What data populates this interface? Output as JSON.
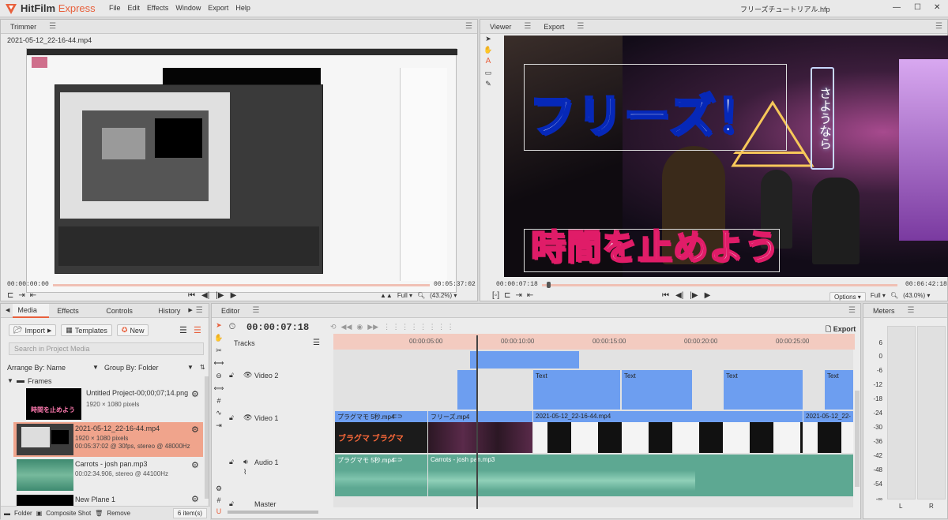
{
  "app": {
    "name_left": "HitFilm",
    "name_right": "Express",
    "file": "フリーズチュートリアル.hfp"
  },
  "menu": [
    "File",
    "Edit",
    "Effects",
    "Window",
    "Export",
    "Help"
  ],
  "window_controls": {
    "min": "—",
    "max": "☐",
    "close": "✕"
  },
  "trimmer": {
    "tab": "Trimmer",
    "filename": "2021-05-12_22-16-44.mp4",
    "time_start": "00:00:00:00",
    "time_end": "00:05:37:02",
    "full": "Full ▾",
    "zoom": "(43.2%) ▾"
  },
  "viewer": {
    "tab": "Viewer",
    "tab2": "Export",
    "time_start": "00:00:07:18",
    "time_end": "00:06:42:18",
    "options": "Options ▾",
    "full": "Full ▾",
    "zoom": "(43.0%) ▾",
    "title_text": "フリーズ！",
    "subtitle_text": "時間を止めよう",
    "sign_text": "さようなら"
  },
  "media": {
    "tabs": [
      "Media",
      "Effects",
      "Controls",
      "History"
    ],
    "import": "Import",
    "templates": "Templates",
    "new": "New",
    "search_placeholder": "Search in Project Media",
    "arrange": "Arrange By: Name",
    "group": "Group By: Folder",
    "folder": "Frames",
    "items": [
      {
        "name": "Untitled Project-00;00;07;14.png",
        "line1": "1920 × 1080 pixels",
        "line2": ""
      },
      {
        "name": "2021-05-12_22-16-44.mp4",
        "line1": "1920 × 1080 pixels",
        "line2": "00:05:37:02 @ 30fps, stereo @ 48000Hz"
      },
      {
        "name": "Carrots - josh pan.mp3",
        "line1": "00:02:34.906, stereo @ 44100Hz",
        "line2": ""
      },
      {
        "name": "New Plane 1",
        "line1": "",
        "line2": ""
      }
    ],
    "footer": {
      "folder": "Folder",
      "composite": "Composite Shot",
      "remove": "Remove",
      "count": "6 item(s)"
    }
  },
  "editor": {
    "tab": "Editor",
    "time": "00:00:07:18",
    "export": "Export",
    "tracks_label": "Tracks",
    "ruler": [
      "00:00:05:00",
      "00:00:10:00",
      "00:00:15:00",
      "00:00:20:00",
      "00:00:25:00"
    ],
    "tracks": [
      "Video 2",
      "Video 1",
      "Audio 1",
      "Master"
    ],
    "video2_clips": [
      "Text",
      "Text",
      "Text",
      "Text"
    ],
    "video1_clips": [
      "プラグマモ 5秒.mp4",
      "フリーズ.mp4",
      "2021-05-12_22-16-44.mp4",
      "2021-05-12_22-"
    ],
    "audio1_clips": [
      "プラグマモ 5秒.mp4",
      "Carrots - josh pan.mp3"
    ]
  },
  "meters": {
    "tab": "Meters",
    "scale": [
      "6",
      "0",
      "-6",
      "-12",
      "-18",
      "-24",
      "-30",
      "-36",
      "-42",
      "-48",
      "-54",
      "-∞"
    ],
    "L": "L",
    "R": "R"
  },
  "colors": {
    "accent": "#e8603c",
    "clip_blue": "#6d9ef0",
    "clip_green": "#5da892",
    "ruler_pink": "#f3cbc0"
  }
}
